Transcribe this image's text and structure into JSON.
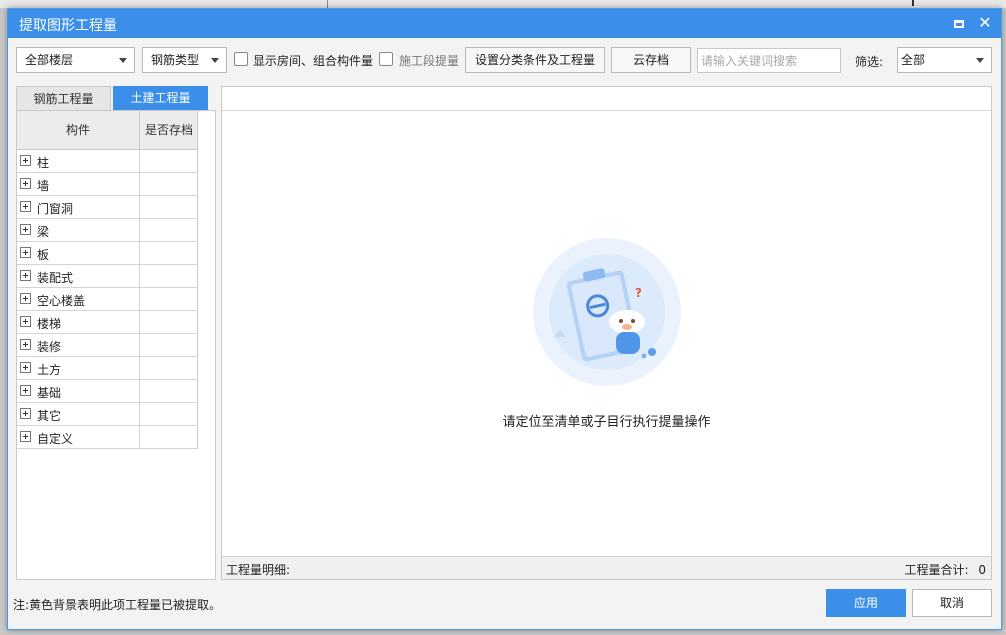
{
  "window": {
    "title": "提取图形工程量"
  },
  "toolbar": {
    "floor_select": "全部楼层",
    "rebar_type_select": "钢筋类型",
    "show_rooms_label": "显示房间、组合构件量",
    "stage_label": "施工段提量",
    "set_conditions_button": "设置分类条件及工程量",
    "cloud_archive_button": "云存档",
    "search_placeholder": "请输入关键词搜索",
    "filter_label": "筛选:",
    "filter_select": "全部"
  },
  "tabs": {
    "rebar": "钢筋工程量",
    "civil": "土建工程量"
  },
  "tree": {
    "col_component": "构件",
    "col_archived": "是否存档",
    "items": [
      {
        "label": "柱"
      },
      {
        "label": "墙"
      },
      {
        "label": "门窗洞"
      },
      {
        "label": "梁"
      },
      {
        "label": "板"
      },
      {
        "label": "装配式"
      },
      {
        "label": "空心楼盖"
      },
      {
        "label": "楼梯"
      },
      {
        "label": "装修"
      },
      {
        "label": "土方"
      },
      {
        "label": "基础"
      },
      {
        "label": "其它"
      },
      {
        "label": "自定义"
      }
    ]
  },
  "main": {
    "empty_message": "请定位至清单或子目行执行提量操作",
    "detail_label": "工程量明细:",
    "total_label": "工程量合计:",
    "total_value": "0"
  },
  "footer": {
    "note": "注:黄色背景表明此项工程量已被提取。",
    "apply_button": "应用",
    "cancel_button": "取消"
  },
  "colors": {
    "accent": "#3b8fe8"
  }
}
